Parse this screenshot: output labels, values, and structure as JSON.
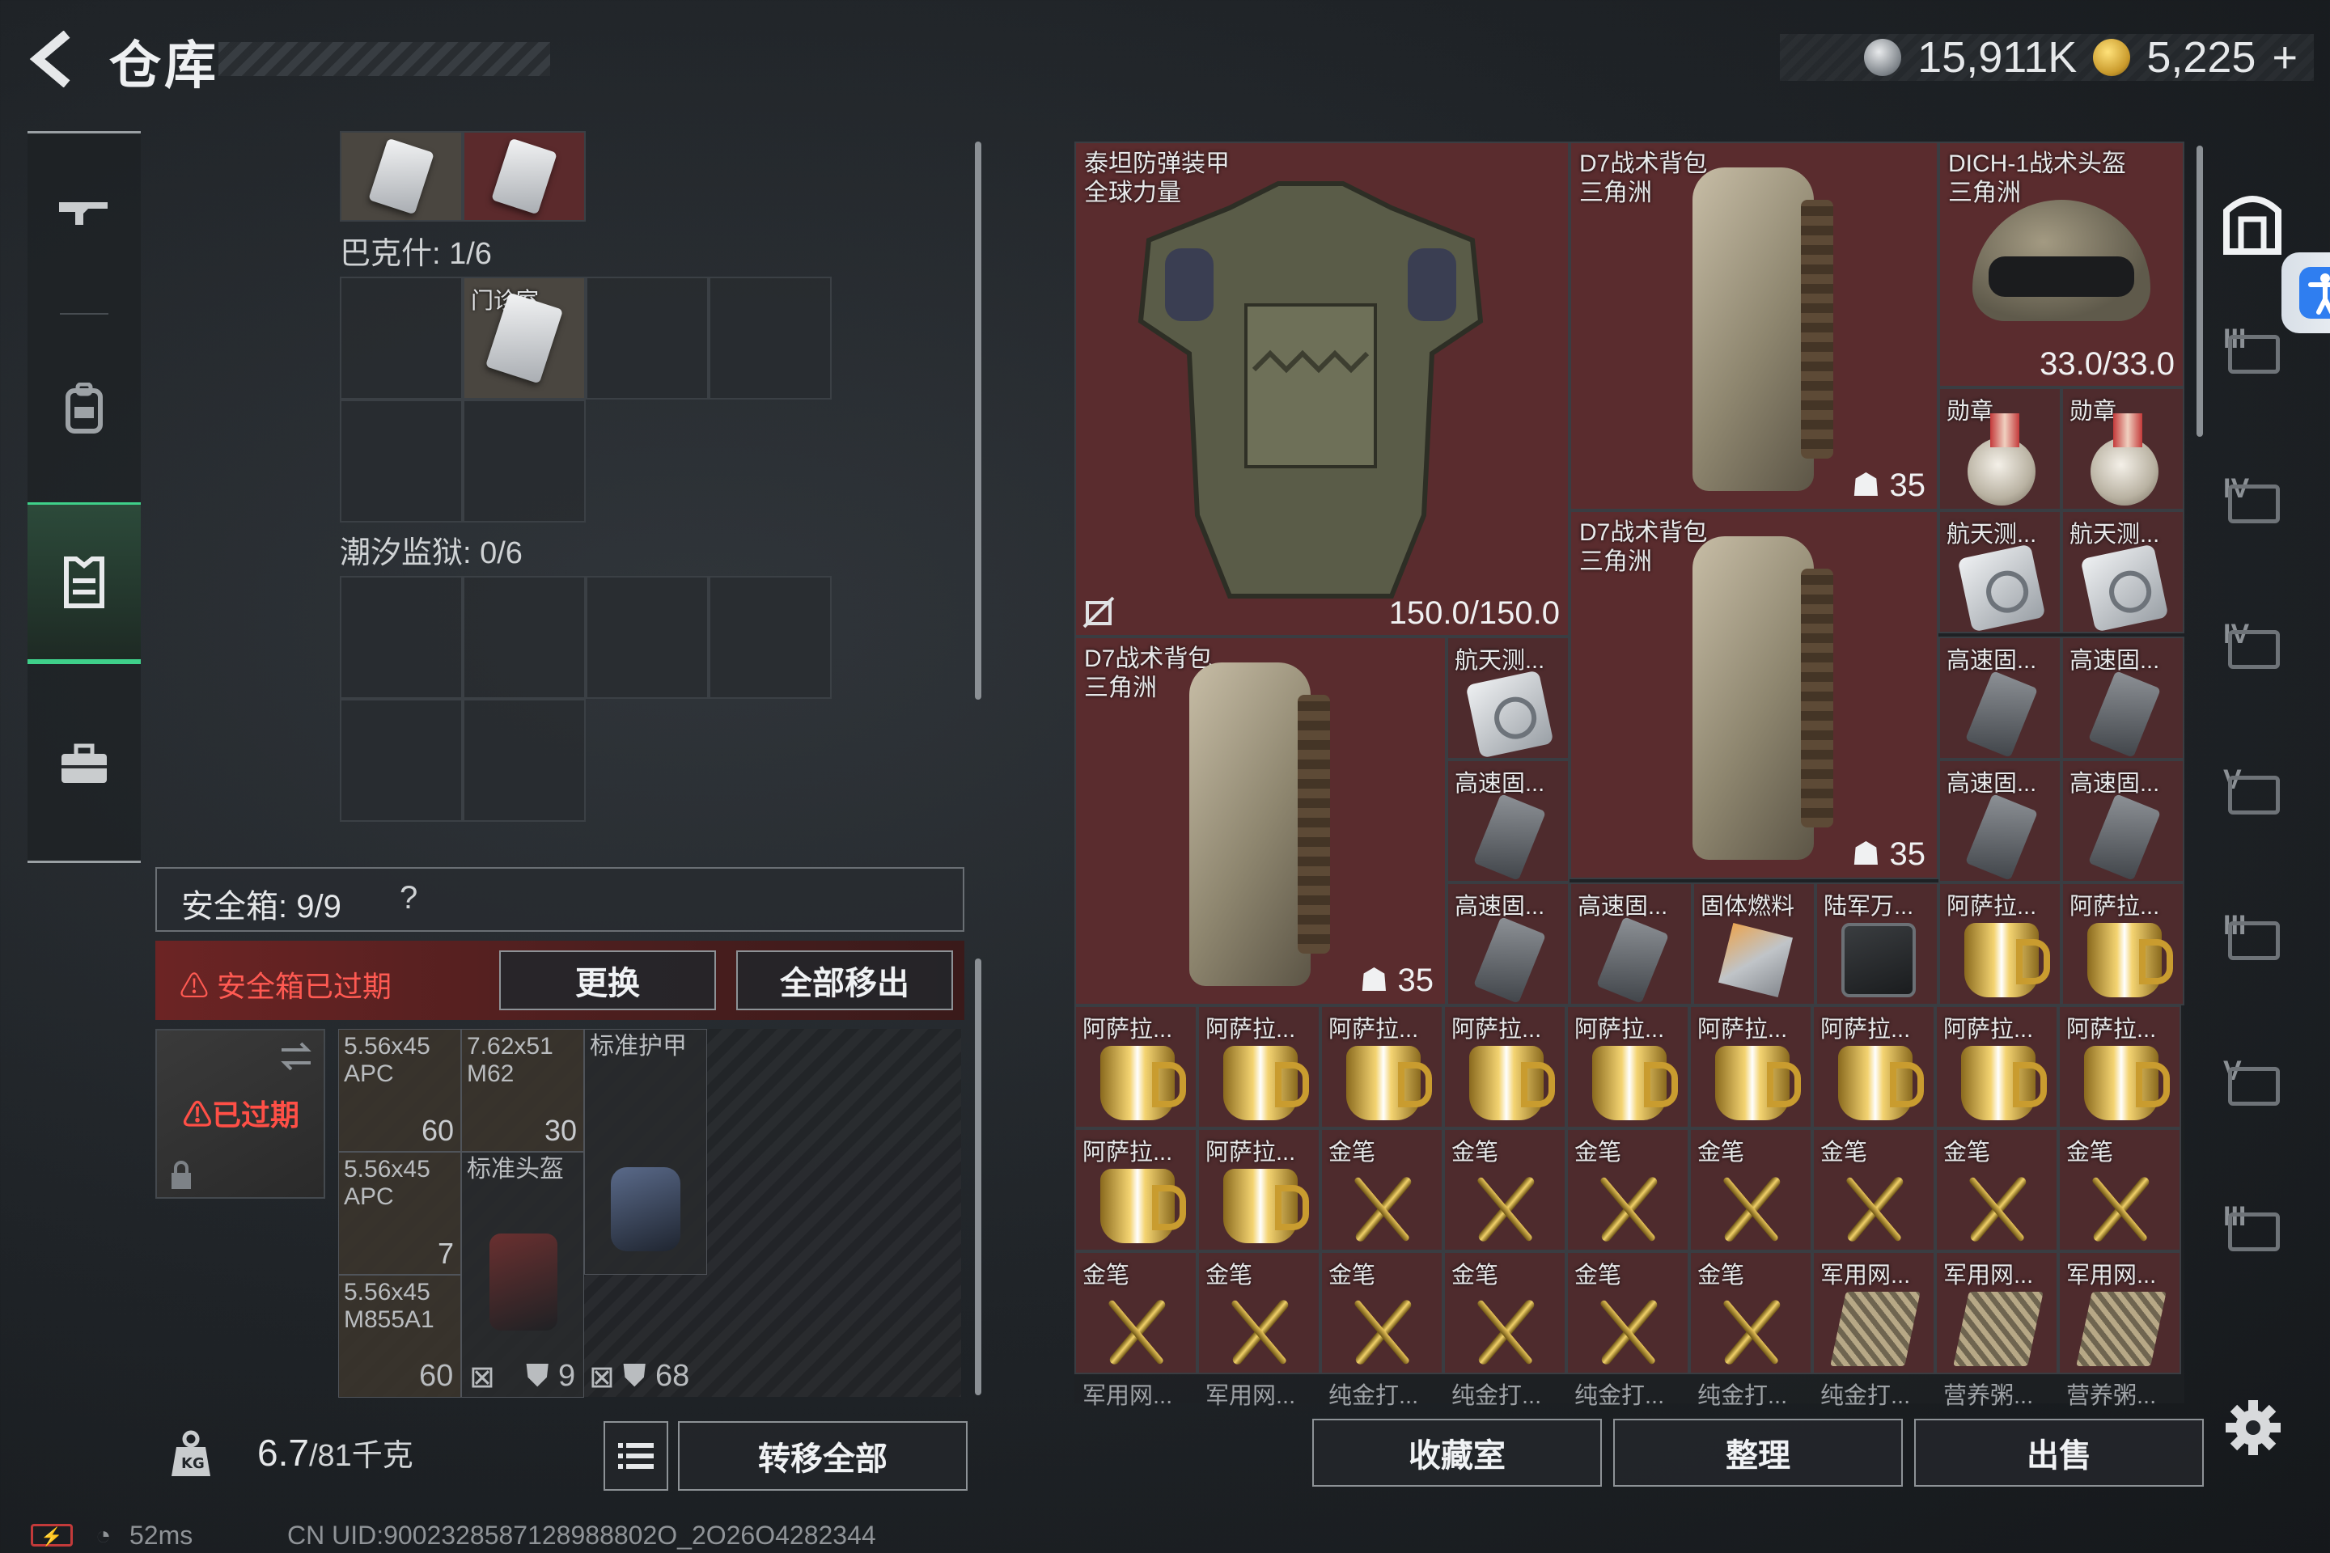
{
  "header": {
    "title": "仓库",
    "currency": [
      {
        "icon": "silver-coin-icon",
        "value": "15,911K"
      },
      {
        "icon": "gold-coin-icon",
        "value": "5,225"
      },
      {
        "icon": "plus-icon",
        "value": "+"
      }
    ]
  },
  "left_nav": [
    {
      "icon": "rifle-icon",
      "active": false
    },
    {
      "icon": "backpack-icon",
      "active": false
    },
    {
      "icon": "vest-icon",
      "active": true
    },
    {
      "icon": "briefcase-icon",
      "active": false
    }
  ],
  "containers": [
    {
      "label": "巴克什: 1/6",
      "item": "门诊室"
    },
    {
      "label": "潮汐监狱: 0/6"
    }
  ],
  "safe_box": {
    "label": "安全箱: 9/9",
    "help": "?",
    "expired_warning": "安全箱已过期",
    "replace_button": "更换",
    "remove_all_button": "全部移出",
    "card_status": "已过期",
    "items": [
      {
        "name": "5.56x45\nAPC",
        "count": "60"
      },
      {
        "name": "7.62x51\nM62",
        "count": "30"
      },
      {
        "name": "标准护甲",
        "count": ""
      },
      {
        "name": "5.56x45\nAPC",
        "count": "7"
      },
      {
        "name": "标准头盔",
        "count": ""
      },
      {
        "name": "5.56x45\nM855A1",
        "count": "60"
      }
    ],
    "footer": {
      "count_a": "60",
      "count_b": "9",
      "count_c": "68"
    }
  },
  "weight": {
    "value": "6.7",
    "max": "/81",
    "unit": "千克"
  },
  "transfer_all_button": "转移全部",
  "storage": {
    "big_items": [
      {
        "name": "泰坦防弹装甲",
        "sub": "全球力量",
        "durability": "150.0/150.0"
      },
      {
        "name": "D7战术背包",
        "sub": "三角洲",
        "weight": "35"
      },
      {
        "name": "DICH-1战术头盔",
        "sub": "三角洲",
        "durability": "33.0/33.0"
      },
      {
        "name": "D7战术背包",
        "sub": "三角洲",
        "weight": "35"
      },
      {
        "name": "D7战术背包",
        "sub": "三角洲",
        "weight": "35"
      }
    ],
    "small_items": {
      "medal": "勋章",
      "aero": "航天测...",
      "drive": "高速固...",
      "fuel": "固体燃料",
      "radio": "陆军万...",
      "mug": "阿萨拉...",
      "pen": "金笔",
      "net": "军用网..."
    },
    "cut_row": [
      "军用网...",
      "军用网...",
      "纯金打...",
      "纯金打...",
      "纯金打...",
      "纯金打...",
      "纯金打...",
      "营养粥...",
      "营养粥..."
    ]
  },
  "bottom_buttons": [
    "收藏室",
    "整理",
    "出售"
  ],
  "status_bar": {
    "ping": "52ms",
    "uid": "CN UID:9002328587128988802O_2O26O4282344"
  }
}
